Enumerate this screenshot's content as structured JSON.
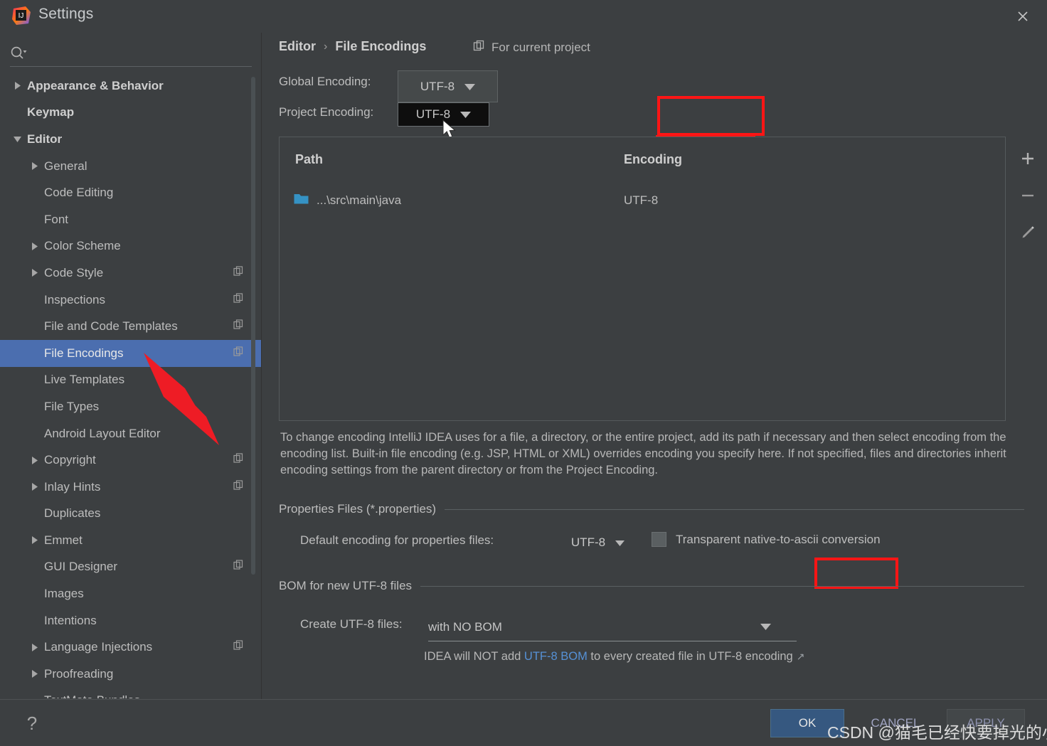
{
  "window": {
    "title": "Settings",
    "logo_icon": "intellij-idea-logo",
    "close_icon": "close-icon"
  },
  "search": {
    "placeholder": "",
    "value": "",
    "icon": "search-icon"
  },
  "sidebar": {
    "items": [
      {
        "label": "Appearance & Behavior",
        "indent": 0,
        "arrow": "right",
        "bold": true,
        "copy": false,
        "selected": false
      },
      {
        "label": "Keymap",
        "indent": 0,
        "arrow": "none",
        "bold": true,
        "copy": false,
        "selected": false
      },
      {
        "label": "Editor",
        "indent": 0,
        "arrow": "down",
        "bold": true,
        "copy": false,
        "selected": false
      },
      {
        "label": "General",
        "indent": 1,
        "arrow": "right",
        "bold": false,
        "copy": false,
        "selected": false
      },
      {
        "label": "Code Editing",
        "indent": 1,
        "arrow": "none",
        "bold": false,
        "copy": false,
        "selected": false
      },
      {
        "label": "Font",
        "indent": 1,
        "arrow": "none",
        "bold": false,
        "copy": false,
        "selected": false
      },
      {
        "label": "Color Scheme",
        "indent": 1,
        "arrow": "right",
        "bold": false,
        "copy": false,
        "selected": false
      },
      {
        "label": "Code Style",
        "indent": 1,
        "arrow": "right",
        "bold": false,
        "copy": true,
        "selected": false
      },
      {
        "label": "Inspections",
        "indent": 1,
        "arrow": "none",
        "bold": false,
        "copy": true,
        "selected": false
      },
      {
        "label": "File and Code Templates",
        "indent": 1,
        "arrow": "none",
        "bold": false,
        "copy": true,
        "selected": false
      },
      {
        "label": "File Encodings",
        "indent": 1,
        "arrow": "none",
        "bold": false,
        "copy": true,
        "selected": true
      },
      {
        "label": "Live Templates",
        "indent": 1,
        "arrow": "none",
        "bold": false,
        "copy": false,
        "selected": false
      },
      {
        "label": "File Types",
        "indent": 1,
        "arrow": "none",
        "bold": false,
        "copy": false,
        "selected": false
      },
      {
        "label": "Android Layout Editor",
        "indent": 1,
        "arrow": "none",
        "bold": false,
        "copy": false,
        "selected": false
      },
      {
        "label": "Copyright",
        "indent": 1,
        "arrow": "right",
        "bold": false,
        "copy": true,
        "selected": false
      },
      {
        "label": "Inlay Hints",
        "indent": 1,
        "arrow": "right",
        "bold": false,
        "copy": true,
        "selected": false
      },
      {
        "label": "Duplicates",
        "indent": 1,
        "arrow": "none",
        "bold": false,
        "copy": false,
        "selected": false
      },
      {
        "label": "Emmet",
        "indent": 1,
        "arrow": "right",
        "bold": false,
        "copy": false,
        "selected": false
      },
      {
        "label": "GUI Designer",
        "indent": 1,
        "arrow": "none",
        "bold": false,
        "copy": true,
        "selected": false
      },
      {
        "label": "Images",
        "indent": 1,
        "arrow": "none",
        "bold": false,
        "copy": false,
        "selected": false
      },
      {
        "label": "Intentions",
        "indent": 1,
        "arrow": "none",
        "bold": false,
        "copy": false,
        "selected": false
      },
      {
        "label": "Language Injections",
        "indent": 1,
        "arrow": "right",
        "bold": false,
        "copy": true,
        "selected": false
      },
      {
        "label": "Proofreading",
        "indent": 1,
        "arrow": "right",
        "bold": false,
        "copy": false,
        "selected": false
      },
      {
        "label": "TextMate Bundles",
        "indent": 1,
        "arrow": "none",
        "bold": false,
        "copy": false,
        "selected": false
      }
    ]
  },
  "main": {
    "breadcrumb": {
      "parent": "Editor",
      "separator": "›",
      "current": "File Encodings"
    },
    "for_current_project": {
      "label": "For current project",
      "icon": "copy-stack-icon"
    },
    "global_encoding": {
      "label": "Global Encoding:",
      "value": "UTF-8"
    },
    "project_encoding": {
      "label": "Project Encoding:",
      "value": "UTF-8"
    },
    "table": {
      "columns": [
        "Path",
        "Encoding"
      ],
      "rows": [
        {
          "icon": "folder-icon",
          "path": "...\\src\\main\\java",
          "encoding": "UTF-8"
        }
      ],
      "tools": [
        {
          "name": "add-button",
          "glyph": "+"
        },
        {
          "name": "remove-button",
          "glyph": "−"
        },
        {
          "name": "edit-button",
          "glyph": "pencil"
        }
      ]
    },
    "description": "To change encoding IntelliJ IDEA uses for a file, a directory, or the entire project, add its path if necessary and then select encoding from the encoding list. Built-in file encoding (e.g. JSP, HTML or XML) overrides encoding you specify here. If not specified, files and directories inherit encoding settings from the parent directory or from the Project Encoding.",
    "properties_section": {
      "title": "Properties Files (*.properties)",
      "default_encoding_label": "Default encoding for properties files:",
      "default_encoding_value": "UTF-8",
      "transparent_label": "Transparent native-to-ascii conversion",
      "transparent_checked": false
    },
    "bom_section": {
      "title": "BOM for new UTF-8 files",
      "create_label": "Create UTF-8 files:",
      "create_value": "with NO BOM",
      "hint_prefix": "IDEA will NOT add ",
      "hint_link": "UTF-8 BOM",
      "hint_suffix": " to every created file in UTF-8 encoding",
      "hint_arrow": "↗"
    }
  },
  "footer": {
    "help": "?",
    "ok": "OK",
    "cancel": "CANCEL",
    "apply": "APPLY"
  },
  "watermark": "CSDN @猫毛已经快要掉光的小猫",
  "colors": {
    "background": "#3c3f41",
    "selection": "#4b6eaf",
    "annotation_red": "#ff1515",
    "link_blue": "#5691d6",
    "ok_button": "#365880",
    "folder_icon": "#3592c4"
  }
}
